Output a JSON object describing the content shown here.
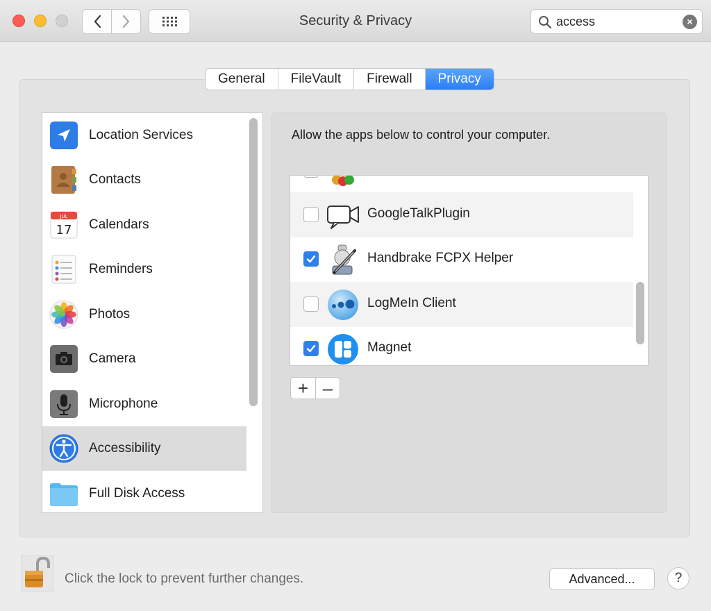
{
  "window": {
    "title": "Security & Privacy"
  },
  "search": {
    "value": "access"
  },
  "tabs": [
    {
      "label": "General"
    },
    {
      "label": "FileVault"
    },
    {
      "label": "Firewall"
    },
    {
      "label": "Privacy",
      "active": true
    }
  ],
  "sidebar": {
    "items": [
      {
        "label": "Location Services",
        "icon": "location-icon"
      },
      {
        "label": "Contacts",
        "icon": "contacts-icon"
      },
      {
        "label": "Calendars",
        "icon": "calendar-icon",
        "icon_month": "JUL",
        "icon_day": "17"
      },
      {
        "label": "Reminders",
        "icon": "reminders-icon"
      },
      {
        "label": "Photos",
        "icon": "photos-icon"
      },
      {
        "label": "Camera",
        "icon": "camera-icon"
      },
      {
        "label": "Microphone",
        "icon": "microphone-icon"
      },
      {
        "label": "Accessibility",
        "icon": "accessibility-icon",
        "selected": true
      },
      {
        "label": "Full Disk Access",
        "icon": "folder-icon"
      }
    ]
  },
  "main": {
    "description": "Allow the apps below to control your computer.",
    "apps": [
      {
        "label": "GoogleTalkPlugin",
        "checked": false,
        "icon": "video-camera-icon"
      },
      {
        "label": "Handbrake FCPX Helper",
        "checked": true,
        "icon": "handbrake-icon"
      },
      {
        "label": "LogMeIn Client",
        "checked": false,
        "icon": "logmein-icon"
      },
      {
        "label": "Magnet",
        "checked": true,
        "icon": "magnet-icon"
      }
    ],
    "add_label": "+",
    "remove_label": "–"
  },
  "footer": {
    "lock_text": "Click the lock to prevent further changes.",
    "advanced_label": "Advanced...",
    "help_label": "?"
  },
  "colors": {
    "accent": "#2f80ed",
    "tab_active": "#2b7ef6"
  }
}
